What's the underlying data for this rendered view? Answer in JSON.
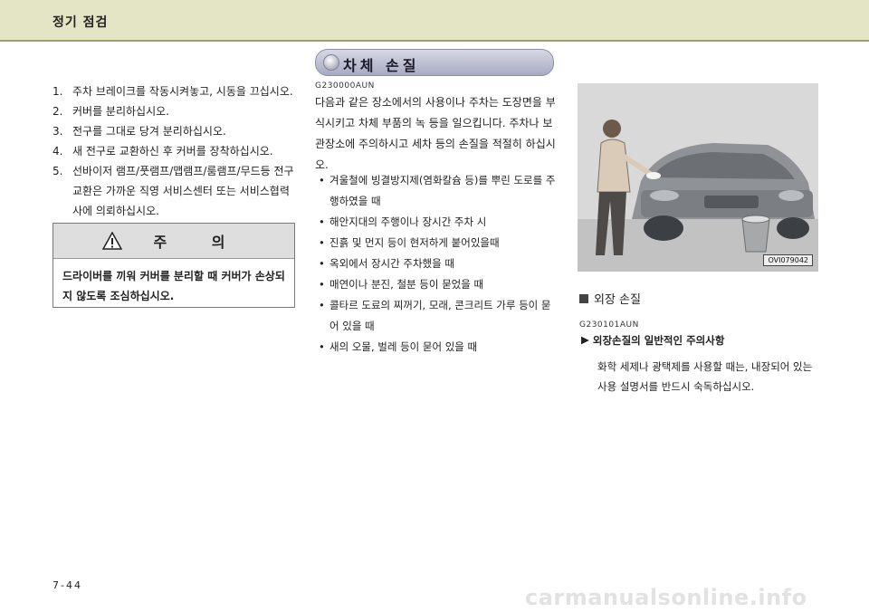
{
  "header": {
    "title": "정기 점검"
  },
  "left": {
    "items": [
      {
        "num": "1.",
        "text": "주차 브레이크를 작동시켜놓고, 시동을 끄십시오."
      },
      {
        "num": "2.",
        "text": "커버를 분리하십시오."
      },
      {
        "num": "3.",
        "text": "전구를 그대로 당겨 분리하십시오."
      },
      {
        "num": "4.",
        "text": "새 전구로 교환하신 후 커버를 장착하십시오."
      },
      {
        "num": "5.",
        "text": "선바이저 램프/풋램프/맵램프/룸램프/무드등 전구교환은 가까운 직영 서비스센터 또는 서비스협력사에 의뢰하십시오."
      }
    ],
    "caution": {
      "title": "주 의",
      "text": "드라이버를 끼워 커버를 분리할 때 커버가 손상되지 않도록 조심하십시오."
    }
  },
  "middle": {
    "pill_title": "차체 손질",
    "code": "G230000AUN",
    "paragraph": "다음과 같은 장소에서의 사용이나 주차는 도장면을 부식시키고 차체 부품의 녹 등을 일으킵니다. 주차나 보관장소에 주의하시고 세차 등의 손질을 적절히 하십시오.",
    "bullets": [
      "겨울철에 빙결방지제(염화칼슘 등)를 뿌린 도로를 주행하였을 때",
      "해안지대의 주행이나 장시간 주차 시",
      "진흙 및 먼지 등이 현저하게 붙어있을때",
      "옥외에서 장시간 주차했을 때",
      "매연이나 분진, 철분 등이 묻었을 때",
      "콜타르 도료의 찌꺼기, 모래, 콘크리트 가루 등이 묻어 있을 때",
      "새의 오물, 벌레 등이 묻어 있을 때"
    ]
  },
  "right": {
    "image_code": "OVI079042",
    "section_title": "외장 손질",
    "code": "G230101AUN",
    "subhead_arrow": "▶",
    "subhead": "외장손질의 일반적인 주의사항",
    "paragraph": "화학 세제나 광택제를 사용할 때는, 내장되어 있는 사용 설명서를 반드시 숙독하십시오."
  },
  "footer": {
    "page": "7-44",
    "watermark": "carmanualsonline.info"
  }
}
